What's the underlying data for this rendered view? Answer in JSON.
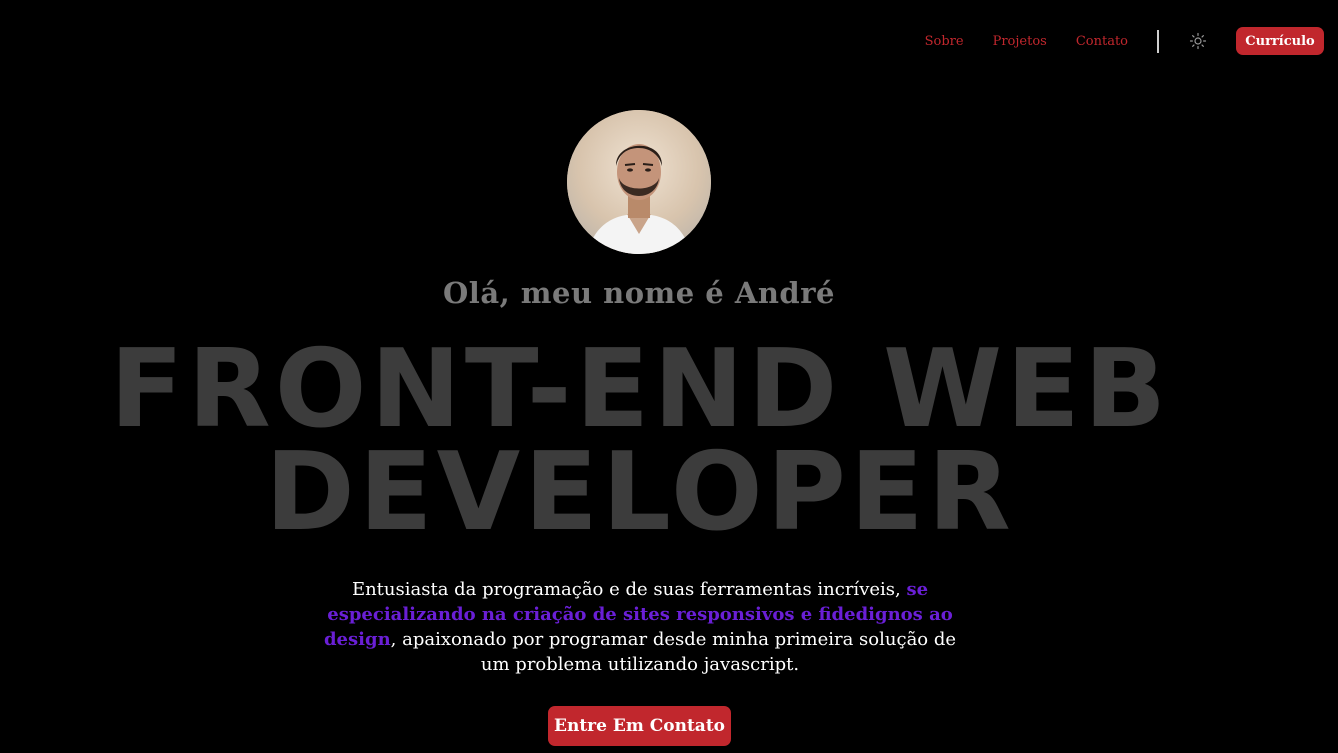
{
  "nav": {
    "links": [
      {
        "label": "Sobre"
      },
      {
        "label": "Projetos"
      },
      {
        "label": "Contato"
      }
    ],
    "theme_icon": "sun-icon",
    "cv_label": "Currículo"
  },
  "hero": {
    "avatar_icon": "profile-photo",
    "greeting": "Olá, meu nome é André",
    "headline_line1": "FRONT-END WEB",
    "headline_line2": "DEVELOPER",
    "description_part1": "Entusiasta da programação e de suas ferramentas incríveis, ",
    "description_highlight": "se especializando na criação de sites responsivos e fidedignos ao design",
    "description_part2": ", apaixonado por programar desde minha primeira solução de um problema utilizando javascript.",
    "contact_label": "Entre Em Contato"
  },
  "colors": {
    "background": "#000000",
    "accent": "#c1272d",
    "highlight": "#6a1fd6",
    "headline": "#3c3c3c",
    "greeting": "#7a7a7a"
  }
}
